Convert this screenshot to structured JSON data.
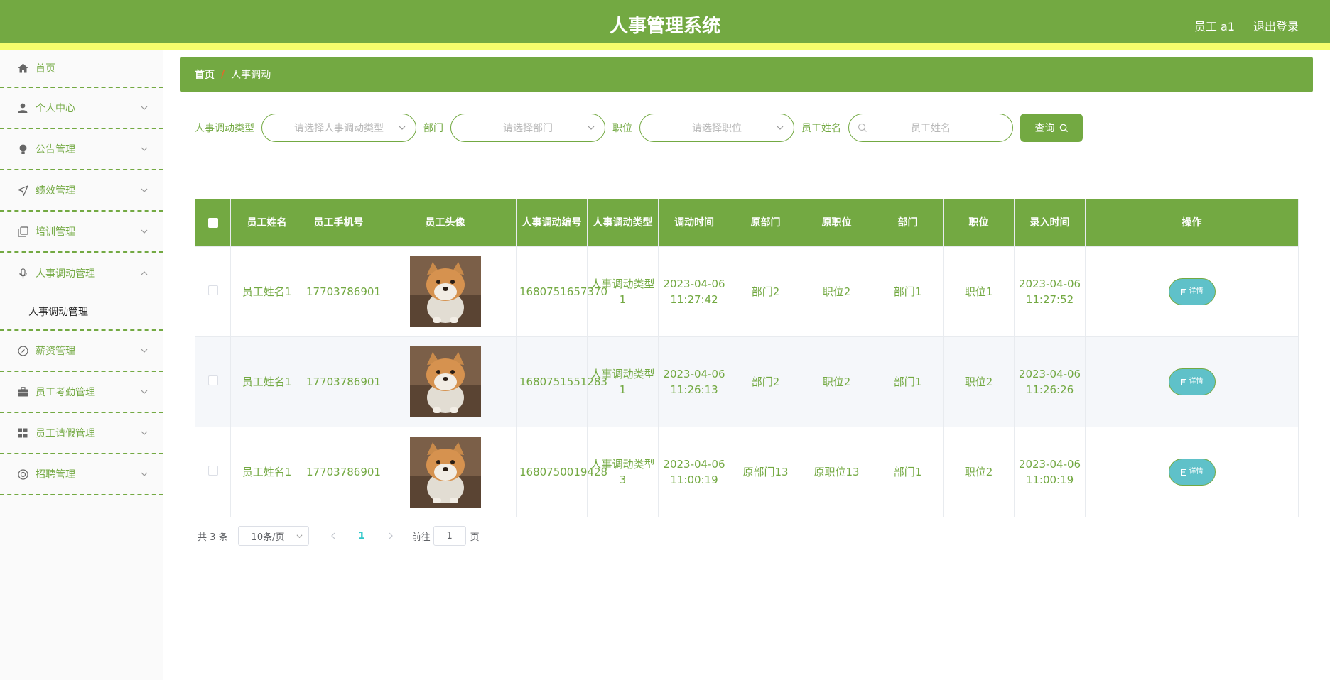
{
  "header": {
    "title": "人事管理系统",
    "user": "员工 a1",
    "logout": "退出登录"
  },
  "sidebar": {
    "items": [
      {
        "label": "首页",
        "icon": "home-icon"
      },
      {
        "label": "个人中心",
        "icon": "user-icon"
      },
      {
        "label": "公告管理",
        "icon": "bulb-icon"
      },
      {
        "label": "绩效管理",
        "icon": "send-icon"
      },
      {
        "label": "培训管理",
        "icon": "copy-icon"
      },
      {
        "label": "人事调动管理",
        "icon": "mic-icon",
        "expanded": true
      },
      {
        "label": "薪资管理",
        "icon": "compass-icon"
      },
      {
        "label": "员工考勤管理",
        "icon": "briefcase-icon"
      },
      {
        "label": "员工请假管理",
        "icon": "grid-icon"
      },
      {
        "label": "招聘管理",
        "icon": "help-ring-icon"
      }
    ],
    "submenu": "人事调动管理"
  },
  "breadcrumb": {
    "home": "首页",
    "separator": "/",
    "current": "人事调动"
  },
  "filters": {
    "type_label": "人事调动类型",
    "type_placeholder": "请选择人事调动类型",
    "dept_label": "部门",
    "dept_placeholder": "请选择部门",
    "pos_label": "职位",
    "pos_placeholder": "请选择职位",
    "name_label": "员工姓名",
    "name_placeholder": "员工姓名",
    "query": "查询"
  },
  "table": {
    "headers": [
      "员工姓名",
      "员工手机号",
      "员工头像",
      "人事调动编号",
      "人事调动类型",
      "调动时间",
      "原部门",
      "原职位",
      "部门",
      "职位",
      "录入时间",
      "操作"
    ],
    "rows": [
      {
        "name": "员工姓名1",
        "phone": "17703786901",
        "no": "1680751657370",
        "type": "人事调动类型1",
        "time": "2023-04-06 11:27:42",
        "old_dept": "部门2",
        "old_pos": "职位2",
        "dept": "部门1",
        "pos": "职位1",
        "created": "2023-04-06 11:27:52",
        "action": "详情"
      },
      {
        "name": "员工姓名1",
        "phone": "17703786901",
        "no": "1680751551283",
        "type": "人事调动类型1",
        "time": "2023-04-06 11:26:13",
        "old_dept": "部门2",
        "old_pos": "职位2",
        "dept": "部门1",
        "pos": "职位2",
        "created": "2023-04-06 11:26:26",
        "action": "详情"
      },
      {
        "name": "员工姓名1",
        "phone": "17703786901",
        "no": "1680750019428",
        "type": "人事调动类型3",
        "time": "2023-04-06 11:00:19",
        "old_dept": "原部门13",
        "old_pos": "原职位13",
        "dept": "部门1",
        "pos": "职位2",
        "created": "2023-04-06 11:00:19",
        "action": "详情"
      }
    ]
  },
  "pagination": {
    "total": "共 3 条",
    "page_size": "10条/页",
    "current": "1",
    "goto_label": "前往",
    "goto_value": "1",
    "page_suffix": "页"
  },
  "colors": {
    "primary": "#73a942",
    "stripe": "#f4fd6c",
    "detail_button": "#5fc1c9"
  }
}
